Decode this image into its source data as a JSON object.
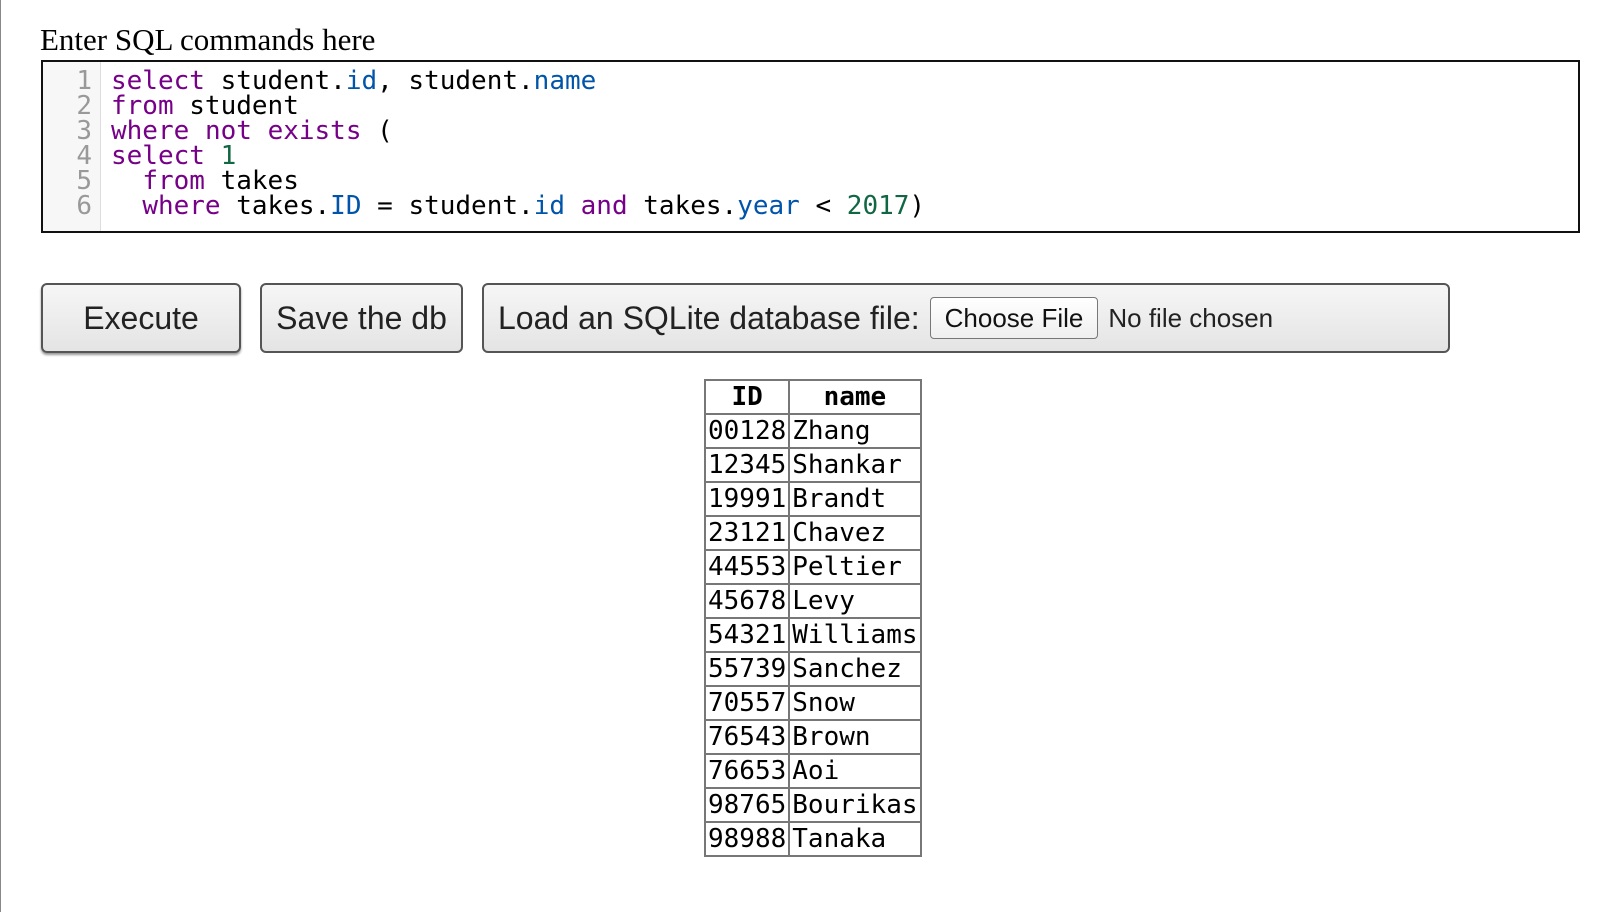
{
  "prompt": {
    "label": "Enter SQL commands here"
  },
  "editor": {
    "line_numbers": [
      "1",
      "2",
      "3",
      "4",
      "5",
      "6"
    ],
    "lines": [
      [
        {
          "t": "select",
          "c": "kw"
        },
        {
          "t": " student",
          "c": ""
        },
        {
          "t": ".",
          "c": "punct"
        },
        {
          "t": "id",
          "c": "prop"
        },
        {
          "t": ", student",
          "c": ""
        },
        {
          "t": ".",
          "c": "punct"
        },
        {
          "t": "name",
          "c": "prop"
        }
      ],
      [
        {
          "t": "from",
          "c": "kw"
        },
        {
          "t": " student",
          "c": ""
        }
      ],
      [
        {
          "t": "where",
          "c": "kw"
        },
        {
          "t": " ",
          "c": ""
        },
        {
          "t": "not",
          "c": "kw"
        },
        {
          "t": " ",
          "c": ""
        },
        {
          "t": "exists",
          "c": "kw"
        },
        {
          "t": " (",
          "c": ""
        }
      ],
      [
        {
          "t": "select",
          "c": "kw"
        },
        {
          "t": " ",
          "c": ""
        },
        {
          "t": "1",
          "c": "num"
        }
      ],
      [
        {
          "t": "  ",
          "c": ""
        },
        {
          "t": "from",
          "c": "kw"
        },
        {
          "t": " takes",
          "c": ""
        }
      ],
      [
        {
          "t": "  ",
          "c": ""
        },
        {
          "t": "where",
          "c": "kw"
        },
        {
          "t": " takes",
          "c": ""
        },
        {
          "t": ".",
          "c": "punct"
        },
        {
          "t": "ID",
          "c": "prop"
        },
        {
          "t": " = student",
          "c": ""
        },
        {
          "t": ".",
          "c": "punct"
        },
        {
          "t": "id",
          "c": "prop"
        },
        {
          "t": " ",
          "c": ""
        },
        {
          "t": "and",
          "c": "kw"
        },
        {
          "t": " takes",
          "c": ""
        },
        {
          "t": ".",
          "c": "punct"
        },
        {
          "t": "year",
          "c": "prop"
        },
        {
          "t": " < ",
          "c": ""
        },
        {
          "t": "2017",
          "c": "num"
        },
        {
          "t": ")",
          "c": ""
        }
      ]
    ]
  },
  "toolbar": {
    "execute_label": "Execute",
    "save_label": "Save the db",
    "load_label": "Load an SQLite database file:",
    "choose_file_label": "Choose File",
    "no_file_label": "No file chosen"
  },
  "results": {
    "columns": [
      "ID",
      "name"
    ],
    "rows": [
      [
        "00128",
        "Zhang"
      ],
      [
        "12345",
        "Shankar"
      ],
      [
        "19991",
        "Brandt"
      ],
      [
        "23121",
        "Chavez"
      ],
      [
        "44553",
        "Peltier"
      ],
      [
        "45678",
        "Levy"
      ],
      [
        "54321",
        "Williams"
      ],
      [
        "55739",
        "Sanchez"
      ],
      [
        "70557",
        "Snow"
      ],
      [
        "76543",
        "Brown"
      ],
      [
        "76653",
        "Aoi"
      ],
      [
        "98765",
        "Bourikas"
      ],
      [
        "98988",
        "Tanaka"
      ]
    ]
  },
  "colors": {
    "keyword": "#770088",
    "property": "#0055aa",
    "number": "#116644"
  }
}
